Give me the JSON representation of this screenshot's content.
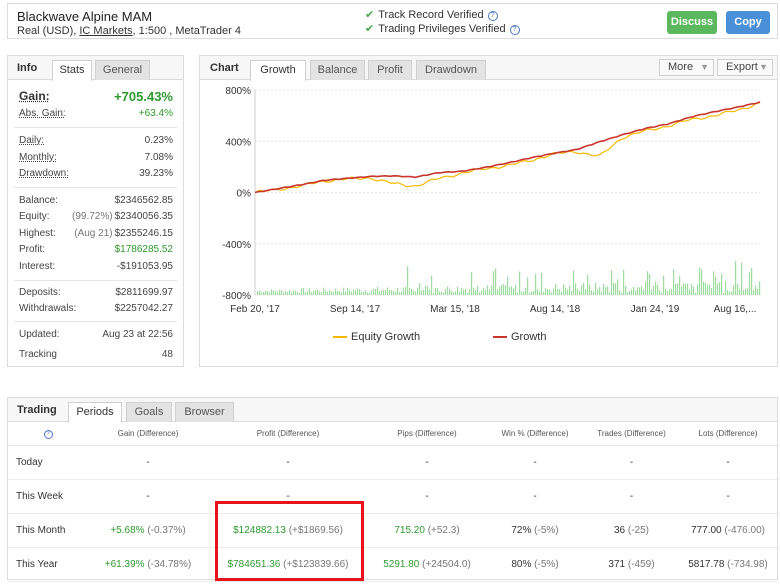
{
  "header": {
    "account_name": "Blackwave Alpine MAM",
    "account_type": "Real (USD),",
    "broker": "IC Markets",
    "account_rest": ", 1:500 , MetaTrader 4",
    "verified_1": "Track Record Verified",
    "verified_2": "Trading Privileges Verified",
    "discuss_label": "Discuss",
    "copy_label": "Copy"
  },
  "info": {
    "title": "Info",
    "tabs": [
      "Stats",
      "General"
    ],
    "gain_label": "Gain:",
    "gain_value": "+705.43%",
    "abs_gain_label": "Abs. Gain:",
    "abs_gain_value": "+63.4%",
    "daily_label": "Daily:",
    "daily_value": "0.23%",
    "monthly_label": "Monthly:",
    "monthly_value": "7.08%",
    "drawdown_label": "Drawdown:",
    "drawdown_value": "39.23%",
    "balance_label": "Balance:",
    "balance_value": "$2346562.85",
    "equity_label": "Equity:",
    "equity_pct": "(99.72%)",
    "equity_value": "$2340056.35",
    "highest_label": "Highest:",
    "highest_date": "(Aug 21)",
    "highest_value": "$2355246.15",
    "profit_label": "Profit:",
    "profit_value": "$1786285.52",
    "interest_label": "Interest:",
    "interest_value": "-$191053.95",
    "deposits_label": "Deposits:",
    "deposits_value": "$2811699.97",
    "withdrawals_label": "Withdrawals:",
    "withdrawals_value": "$2257042.27",
    "updated_label": "Updated:",
    "updated_value": "Aug 23 at 22:56",
    "tracking_label": "Tracking",
    "tracking_value": "48"
  },
  "chart": {
    "title": "Chart",
    "tabs": [
      "Growth",
      "Balance",
      "Profit",
      "Drawdown"
    ],
    "more_label": "More",
    "export_label": "Export",
    "legend_equity": "Equity Growth",
    "legend_growth": "Growth",
    "colors": {
      "equity": "#f5b800",
      "growth": "#c8352b",
      "volume": "#9fdc9f"
    }
  },
  "chart_data": {
    "type": "line",
    "x_ticks": [
      "Feb 20, '17",
      "Sep 14, '17",
      "Mar 15, '18",
      "Aug 14, '18",
      "Jan 24, '19",
      "Aug 16,..."
    ],
    "y_ticks": [
      "800%",
      "400%",
      "0%",
      "-400%",
      "-800%"
    ],
    "ylim": [
      -800,
      800
    ],
    "series": [
      {
        "name": "Growth",
        "values": [
          0,
          30,
          60,
          95,
          110,
          125,
          130,
          120,
          155,
          165,
          195,
          230,
          270,
          305,
          335,
          395,
          450,
          500,
          535,
          590,
          630,
          665,
          705
        ]
      },
      {
        "name": "Equity Growth",
        "values": [
          0,
          25,
          50,
          90,
          105,
          115,
          70,
          50,
          110,
          150,
          185,
          210,
          250,
          300,
          320,
          280,
          430,
          480,
          520,
          570,
          600,
          640,
          700
        ]
      }
    ]
  },
  "trading": {
    "title": "Trading",
    "tabs": [
      "Periods",
      "Goals",
      "Browser"
    ],
    "columns": [
      "Gain (Difference)",
      "Profit (Difference)",
      "Pips (Difference)",
      "Win % (Difference)",
      "Trades (Difference)",
      "Lots (Difference)"
    ],
    "rows": [
      {
        "period": "Today",
        "gain": "-",
        "gain_diff": "",
        "profit": "-",
        "profit_diff": "",
        "pips": "-",
        "pips_diff": "",
        "win": "-",
        "win_diff": "",
        "trades": "-",
        "trades_diff": "",
        "lots": "-",
        "lots_diff": ""
      },
      {
        "period": "This Week",
        "gain": "-",
        "gain_diff": "",
        "profit": "-",
        "profit_diff": "",
        "pips": "-",
        "pips_diff": "",
        "win": "-",
        "win_diff": "",
        "trades": "-",
        "trades_diff": "",
        "lots": "-",
        "lots_diff": ""
      },
      {
        "period": "This Month",
        "gain": "+5.68%",
        "gain_diff": "(-0.37%)",
        "profit": "$124882.13",
        "profit_diff": "(+$1869.56)",
        "pips": "715.20",
        "pips_diff": "(+52.3)",
        "win": "72%",
        "win_diff": "(-5%)",
        "trades": "36",
        "trades_diff": "(-25)",
        "lots": "777.00",
        "lots_diff": "(-476.00)"
      },
      {
        "period": "This Year",
        "gain": "+61.39%",
        "gain_diff": "(-34.78%)",
        "profit": "$784651.36",
        "profit_diff": "(+$123839.66)",
        "pips": "5291.80",
        "pips_diff": "(+24504.0)",
        "win": "80%",
        "win_diff": "(-5%)",
        "trades": "371",
        "trades_diff": "(-459)",
        "lots": "5817.78",
        "lots_diff": "(-734.98)"
      }
    ]
  }
}
